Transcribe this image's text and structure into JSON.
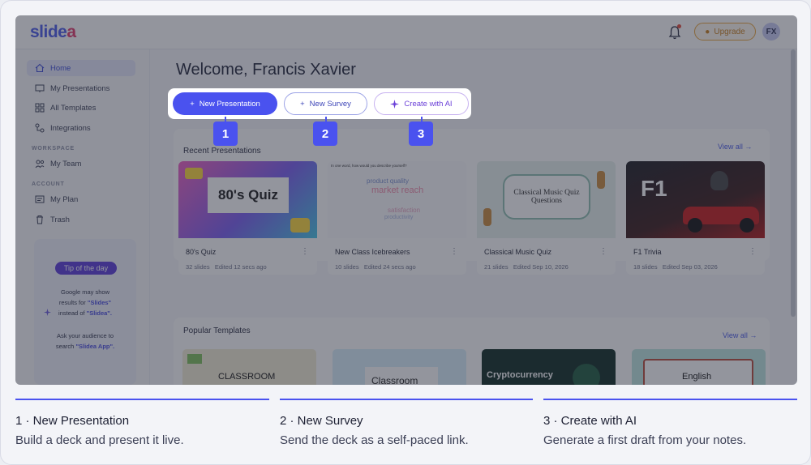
{
  "app": {
    "logo_main": "slide",
    "logo_accent": "a"
  },
  "topbar": {
    "upgrade_label": "Upgrade",
    "avatar_initials": "FX"
  },
  "sidebar": {
    "items": [
      {
        "label": "Home"
      },
      {
        "label": "My Presentations"
      },
      {
        "label": "All Templates"
      },
      {
        "label": "Integrations"
      }
    ],
    "workspace_label": "WORKSPACE",
    "workspace_items": [
      {
        "label": "My Team"
      }
    ],
    "account_label": "ACCOUNT",
    "account_items": [
      {
        "label": "My Plan"
      },
      {
        "label": "Trash"
      }
    ],
    "tip": {
      "badge": "Tip of the day",
      "line1": "Google may show",
      "line2_pre": "results for ",
      "line2_q": "\"Slides\"",
      "line3_pre": "instead of ",
      "line3_q": "\"Slidea\".",
      "line4": "Ask your audience to",
      "line5_pre": "search ",
      "line5_q": "\"Slidea App\"."
    }
  },
  "main": {
    "welcome": "Welcome, Francis Xavier",
    "buttons": {
      "new_presentation": "New Presentation",
      "new_survey": "New Survey",
      "create_ai": "Create with AI"
    },
    "markers": [
      "1",
      "2",
      "3"
    ],
    "recent": {
      "title": "Recent Presentations",
      "view_all": "View all →",
      "cards": [
        {
          "title": "80's Quiz",
          "slides": "32 slides",
          "edited": "Edited 12 secs ago",
          "thumb_text": "80's Quiz"
        },
        {
          "title": "New Class Icebreakers",
          "slides": "10 slides",
          "edited": "Edited 24 secs ago",
          "thumb_text": "In one word, how would you describe yourself?"
        },
        {
          "title": "Classical Music Quiz",
          "slides": "21 slides",
          "edited": "Edited Sep 10, 2026",
          "thumb_text": "Classical Music Quiz Questions"
        },
        {
          "title": "F1 Trivia",
          "slides": "18 slides",
          "edited": "Edited Sep 03, 2026",
          "thumb_text": "F1"
        }
      ],
      "word_cloud": [
        "product quality",
        "market reach",
        "satisfaction",
        "productivity"
      ]
    },
    "popular": {
      "title": "Popular Templates",
      "view_all": "View all →",
      "cards": [
        {
          "thumb_text": "CLASSROOM"
        },
        {
          "thumb_text": "Classroom"
        },
        {
          "thumb_text": "Cryptocurrency"
        },
        {
          "thumb_text": "English"
        }
      ]
    }
  },
  "legend": [
    {
      "title": "1 · New Presentation",
      "desc": "Build a deck and present it live."
    },
    {
      "title": "2 · New Survey",
      "desc": "Send the deck as a self-paced link."
    },
    {
      "title": "3 · Create with AI",
      "desc": "Generate a first draft from your notes."
    }
  ],
  "colors": {
    "accent": "#4a52ef",
    "brand_pink": "#e0386b",
    "upgrade": "#e8a33a"
  }
}
